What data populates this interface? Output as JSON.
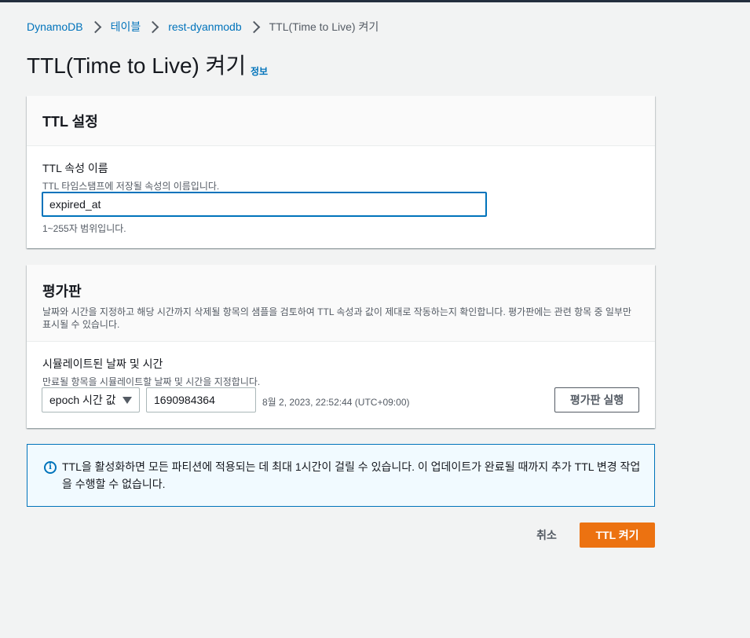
{
  "breadcrumb": {
    "items": [
      "DynamoDB",
      "테이블",
      "rest-dyanmodb"
    ],
    "current": "TTL(Time to Live) 켜기"
  },
  "page": {
    "title": "TTL(Time to Live) 켜기",
    "info_link": "정보"
  },
  "ttl_settings": {
    "title": "TTL 설정",
    "attr_label": "TTL 속성 이름",
    "attr_desc": "TTL 타임스탬프에 저장될 속성의 이름입니다.",
    "attr_value": "expired_at",
    "constraint": "1~255자 범위입니다."
  },
  "preview": {
    "title": "평가판",
    "desc": "날짜와 시간을 지정하고 해당 시간까지 삭제될 항목의 샘플을 검토하여 TTL 속성과 값이 제대로 작동하는지 확인합니다. 평가판에는 관련 항목 중 일부만 표시될 수 있습니다.",
    "sim_label": "시뮬레이트된 날짜 및 시간",
    "sim_desc": "만료될 항목을 시뮬레이트할 날짜 및 시간을 지정합니다.",
    "select_value": "epoch 시간 값",
    "epoch_value": "1690984364",
    "date_text": "8월 2, 2023, 22:52:44 (UTC+09:00)",
    "run_button": "평가판 실행"
  },
  "alert": {
    "icon": "info-icon",
    "text": "TTL을 활성화하면 모든 파티션에 적용되는 데 최대 1시간이 걸릴 수 있습니다. 이 업데이트가 완료될 때까지 추가 TTL 변경 작업을 수행할 수 없습니다."
  },
  "actions": {
    "cancel": "취소",
    "submit": "TTL 켜기"
  },
  "colors": {
    "link": "#0073bb",
    "primary": "#ec7211",
    "background": "#f2f3f3"
  }
}
